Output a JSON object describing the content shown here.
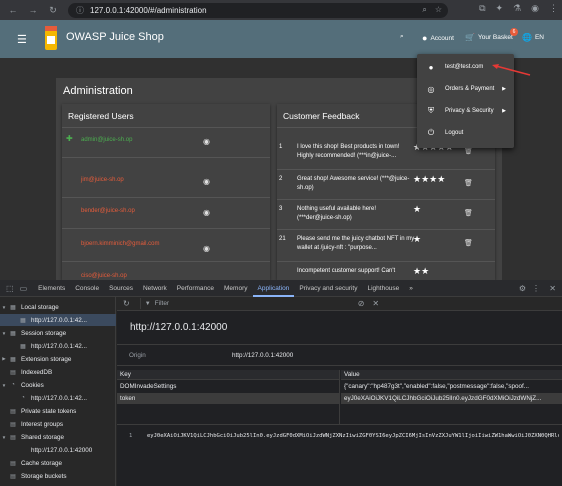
{
  "browser": {
    "url": "127.0.0.1:42000/#/administration"
  },
  "app": {
    "title": "OWASP Juice Shop",
    "account_label": "Account",
    "basket_label": "Your Basket",
    "basket_count": "6",
    "language": "EN"
  },
  "admin": {
    "title": "Administration",
    "users_heading": "Registered Users",
    "feedback_heading": "Customer Feedback",
    "users": [
      {
        "email": "admin@juice-sh.op"
      },
      {
        "email": "jim@juice-sh.op"
      },
      {
        "email": "bender@juice-sh.op"
      },
      {
        "email": "bjoern.kimminich@gmail.com"
      },
      {
        "email": "ciso@juice-sh.op"
      }
    ],
    "feedback": [
      {
        "id": "1",
        "text": "I love this shop! Best products in town! Highly recommended! (***in@juice-...",
        "stars": "★★★★★"
      },
      {
        "id": "2",
        "text": "Great shop! Awesome service! (***@juice-sh.op)",
        "stars": "★★★★"
      },
      {
        "id": "3",
        "text": "Nothing useful available here! (***der@juice-sh.op)",
        "stars": "★"
      },
      {
        "id": "21",
        "text": "Please send me the juicy chatbot NFT in my wallet at /juicy-nft : \"purpose...",
        "stars": "★"
      },
      {
        "id": "",
        "text": "Incompetent customer support! Can't",
        "stars": "★★"
      }
    ]
  },
  "account_menu": {
    "items": [
      {
        "label": "test@test.com",
        "icon": "person-icon"
      },
      {
        "label": "Orders & Payment",
        "icon": "check-circle-icon"
      },
      {
        "label": "Privacy & Security",
        "icon": "shield-icon"
      },
      {
        "label": "Logout",
        "icon": "power-icon"
      }
    ]
  },
  "devtools": {
    "tabs": [
      "Elements",
      "Console",
      "Sources",
      "Network",
      "Performance",
      "Memory",
      "Application",
      "Privacy and security",
      "Lighthouse",
      "»"
    ],
    "active_tab": "Application",
    "filter_placeholder": "Filter",
    "sidebar": [
      {
        "label": "Local storage",
        "icon": "table-icon",
        "level": 0,
        "tri": "▼"
      },
      {
        "label": "http://127.0.0.1:42...",
        "icon": "table-icon",
        "level": 1,
        "tri": "",
        "selected": true
      },
      {
        "label": "Session storage",
        "icon": "table-icon",
        "level": 0,
        "tri": "▼"
      },
      {
        "label": "http://127.0.0.1:42...",
        "icon": "table-icon",
        "level": 1,
        "tri": ""
      },
      {
        "label": "Extension storage",
        "icon": "table-icon",
        "level": 0,
        "tri": "▶"
      },
      {
        "label": "IndexedDB",
        "icon": "db-icon",
        "level": 0,
        "tri": ""
      },
      {
        "label": "Cookies",
        "icon": "cookie-icon",
        "level": 0,
        "tri": "▼"
      },
      {
        "label": "http://127.0.0.1:42...",
        "icon": "cookie-icon",
        "level": 1,
        "tri": ""
      },
      {
        "label": "Private state tokens",
        "icon": "db-icon",
        "level": 0,
        "tri": ""
      },
      {
        "label": "Interest groups",
        "icon": "db-icon",
        "level": 0,
        "tri": ""
      },
      {
        "label": "Shared storage",
        "icon": "db-icon",
        "level": 0,
        "tri": "▼"
      },
      {
        "label": "http://127.0.0.1:42000",
        "icon": "",
        "level": 1,
        "tri": ""
      },
      {
        "label": "Cache storage",
        "icon": "db-icon",
        "level": 0,
        "tri": ""
      },
      {
        "label": "Storage buckets",
        "icon": "db-icon",
        "level": 0,
        "tri": ""
      }
    ],
    "origin_title": "http://127.0.0.1:42000",
    "origin_label": "Origin",
    "origin_value": "http://127.0.0.1:42000",
    "table": {
      "key_header": "Key",
      "value_header": "Value",
      "rows": [
        {
          "key": "DOMInvadeSettings",
          "value": "{\"canary\":\"hp487g3t\",\"enabled\":false,\"postmessage\":false,\"spoof..."
        },
        {
          "key": "token",
          "value": "eyJ0eXAiOiJKV1QiLCJhbGciOiJub25lIn0.eyJzdGF0dXMiOiJzdWNjZ..."
        }
      ]
    },
    "preview_line_no": "1",
    "preview_text": "eyJ0eXAiOiJKV1QiLCJhbGciOiJub25lIn0.eyJzdGF0dXMiOiJzdWNjZXNzIiwiZGF0YSI6eyJpZCI6MjIsInVzZXJuYW1lIjoiIiwiZW1haWwiOiJ0ZXN0QHRlc3QuY29tIiwicGFzc3dvcmQiOi..."
  }
}
